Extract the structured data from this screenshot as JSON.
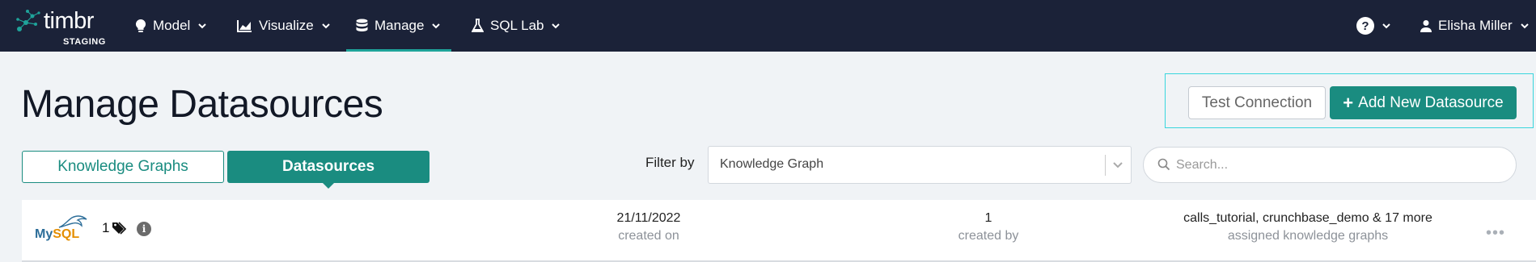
{
  "brand": {
    "name": "timbr",
    "env": "STAGING"
  },
  "nav": {
    "items": [
      {
        "label": "Model",
        "icon": "lightbulb-icon"
      },
      {
        "label": "Visualize",
        "icon": "chart-icon"
      },
      {
        "label": "Manage",
        "icon": "database-icon",
        "active": true
      },
      {
        "label": "SQL Lab",
        "icon": "flask-icon"
      }
    ],
    "help_glyph": "?",
    "user_name": "Elisha Miller"
  },
  "page": {
    "title": "Manage Datasources"
  },
  "actions": {
    "test_connection": "Test Connection",
    "add_new": "Add New Datasource",
    "add_glyph": "+"
  },
  "tabs": {
    "knowledge_graphs": "Knowledge Graphs",
    "datasources": "Datasources"
  },
  "filter": {
    "label": "Filter by",
    "selected": "Knowledge Graph"
  },
  "search": {
    "placeholder": "Search..."
  },
  "rows": [
    {
      "logo": {
        "my": "My",
        "sql": "SQL"
      },
      "count": "1",
      "info_glyph": "i",
      "created_on": {
        "value": "21/11/2022",
        "label": "created on"
      },
      "created_by": {
        "value": "1",
        "label": "created by"
      },
      "assigned": {
        "value": "calls_tutorial, crunchbase_demo & 17 more",
        "label": "assigned knowledge graphs"
      },
      "more_glyph": "•••"
    }
  ],
  "colors": {
    "nav_bg": "#1b2238",
    "accent": "#1a8c80",
    "page_bg": "#f0f3f6",
    "focus_outline": "#38d6dd"
  }
}
